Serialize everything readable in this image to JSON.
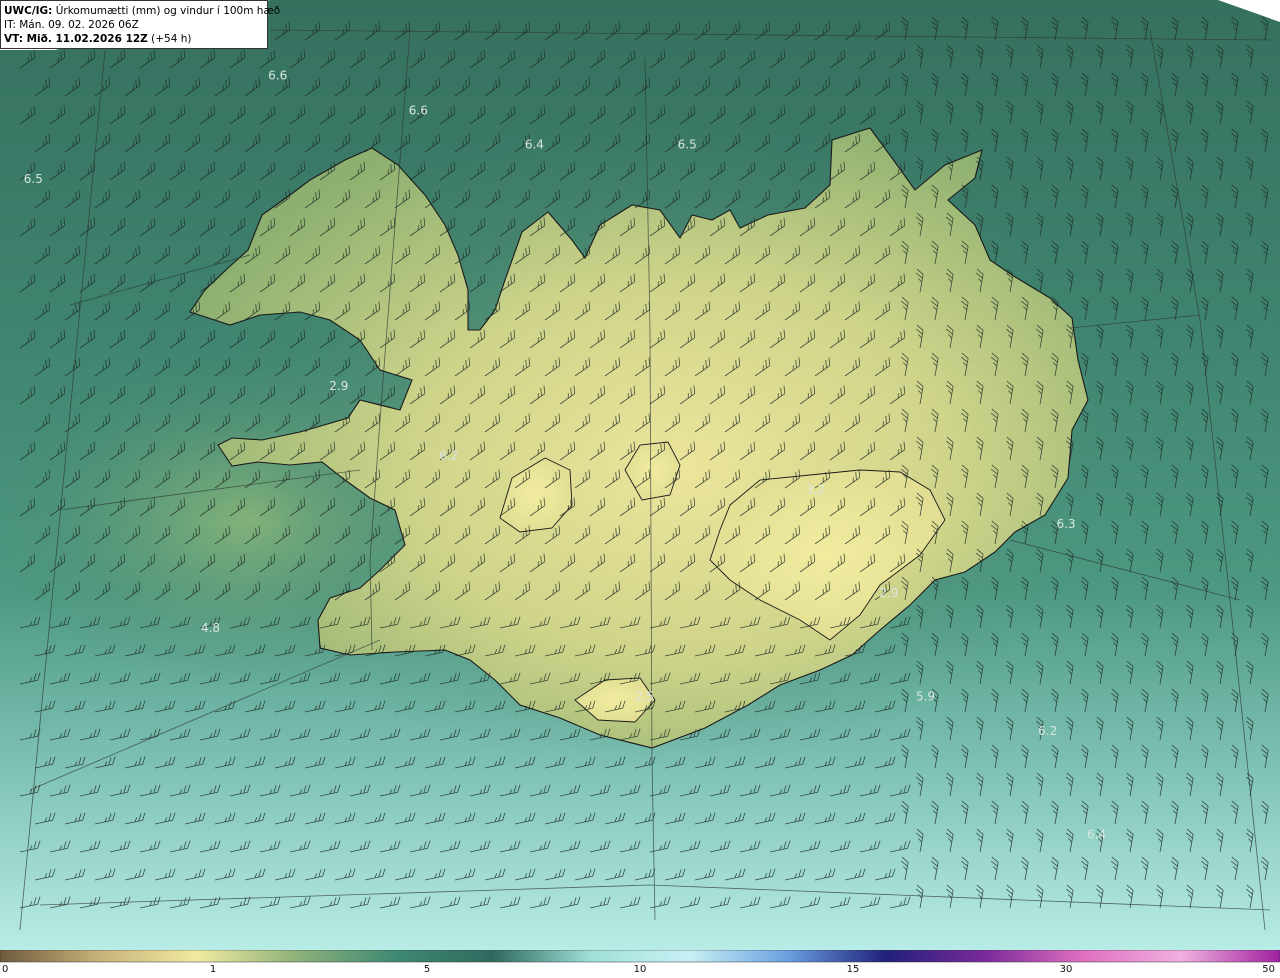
{
  "header": {
    "model_label": "UWC/IG:",
    "title": "Úrkomumætti (mm) og vindur í 100m hæð",
    "init_label": "IT:",
    "init_time": "Mán. 09. 02. 2026 06Z",
    "valid_label": "VT:",
    "valid_time": "Mið. 11.02.2026 12Z",
    "lead": "(+54 h)"
  },
  "map_labels": [
    {
      "text": "6.5",
      "lon": -28.6,
      "lat": 67.4
    },
    {
      "text": "6.6",
      "lon": -24.6,
      "lat": 67.7
    },
    {
      "text": "6.6",
      "lon": -22.3,
      "lat": 67.6
    },
    {
      "text": "6.4",
      "lon": -20.4,
      "lat": 67.5
    },
    {
      "text": "6.5",
      "lon": -17.9,
      "lat": 67.5
    },
    {
      "text": "2.9",
      "lon": -23.6,
      "lat": 66.8
    },
    {
      "text": "6.2",
      "lon": -21.8,
      "lat": 66.6
    },
    {
      "text": "4.8",
      "lon": -25.7,
      "lat": 66.1
    },
    {
      "text": "3.2",
      "lon": -15.8,
      "lat": 66.5
    },
    {
      "text": "2.9",
      "lon": -14.6,
      "lat": 66.2
    },
    {
      "text": "2.5",
      "lon": -18.6,
      "lat": 65.9
    },
    {
      "text": "5.9",
      "lon": -14.0,
      "lat": 65.9
    },
    {
      "text": "6.3",
      "lon": -11.7,
      "lat": 66.4
    },
    {
      "text": "6.2",
      "lon": -12.0,
      "lat": 65.8
    },
    {
      "text": "6.4",
      "lon": -11.2,
      "lat": 65.5
    }
  ],
  "colorbar": {
    "ticks": [
      "0",
      "1",
      "5",
      "10",
      "15",
      "30",
      "50"
    ],
    "colors": [
      "#6e5a3c",
      "#c7b27a",
      "#f0eaa0",
      "#8fb27a",
      "#3f8a74",
      "#2e6a5e",
      "#9fe0d8",
      "#c8f0f4",
      "#6aa0e0",
      "#20207a",
      "#7a2a9a",
      "#e070c0",
      "#f0b0e0",
      "#a020a0"
    ]
  },
  "colors": {
    "land_high": "#e9e39a",
    "land_mid": "#a8bb78",
    "sea_north": "#3d7f6c",
    "sea_south": "#a6e0da",
    "coast": "#1a1a1a",
    "barb": "#1e2b26"
  }
}
